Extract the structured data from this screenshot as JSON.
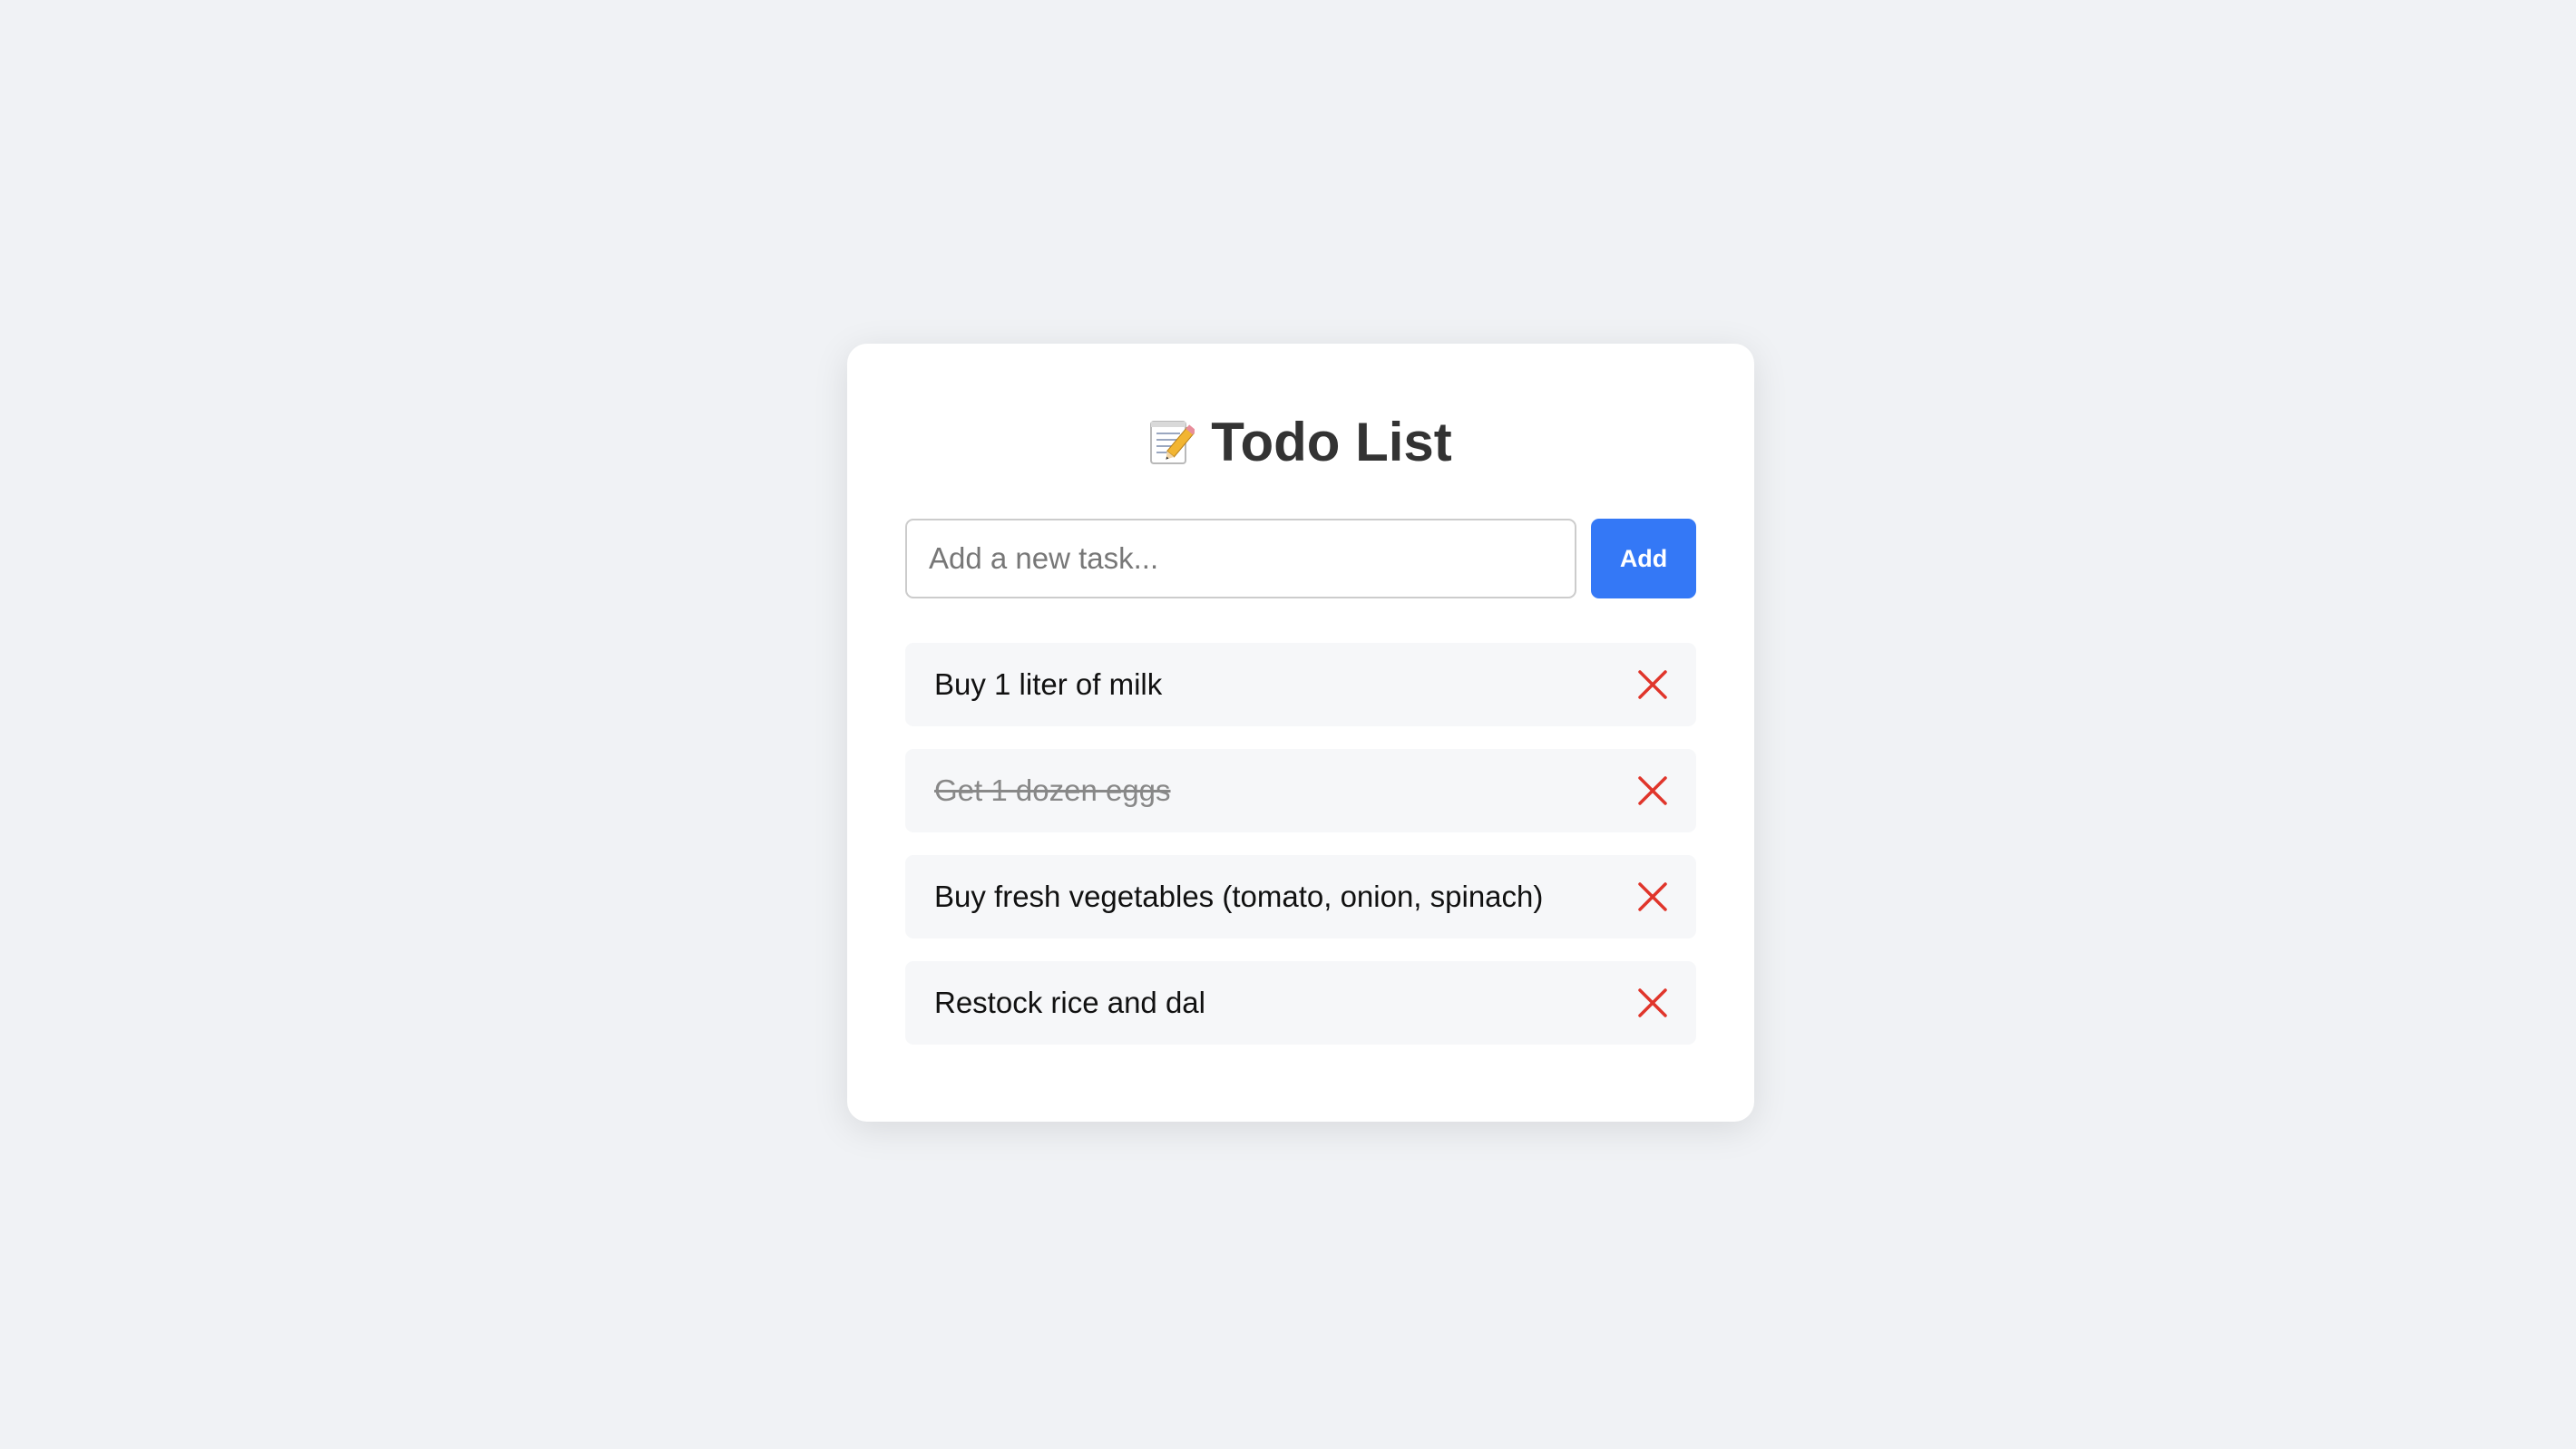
{
  "app": {
    "title": "Todo List",
    "title_icon": "memo-pencil-icon"
  },
  "input": {
    "placeholder": "Add a new task...",
    "value": ""
  },
  "add_button": {
    "label": "Add"
  },
  "tasks": [
    {
      "text": "Buy 1 liter of milk",
      "completed": false
    },
    {
      "text": "Get 1 dozen eggs",
      "completed": true
    },
    {
      "text": "Buy fresh vegetables (tomato, onion, spinach)",
      "completed": false
    },
    {
      "text": "Restock rice and dal",
      "completed": false
    }
  ],
  "delete_icon": "close-icon",
  "colors": {
    "background": "#f0f2f5",
    "card": "#ffffff",
    "accent": "#3478f6",
    "delete": "#e0352b",
    "task_background": "#f6f7f9",
    "completed_text": "#888888"
  }
}
